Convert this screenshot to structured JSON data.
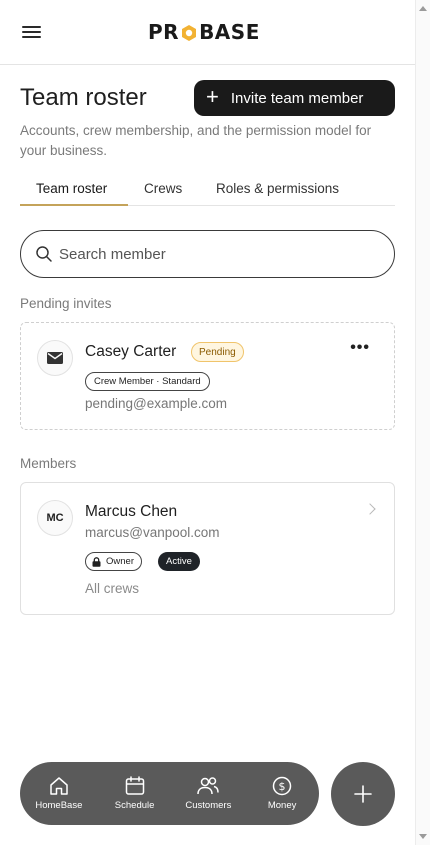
{
  "header": {
    "logo_text_left": "PR",
    "logo_text_right": "BASE",
    "brand_accent": "#F2B233"
  },
  "page": {
    "title": "Team roster",
    "invite_button_label": "Invite team member",
    "subtitle": "Accounts, crew membership, and the permission model for your business."
  },
  "tabs": [
    {
      "label": "Team roster",
      "active": true
    },
    {
      "label": "Crews",
      "active": false
    },
    {
      "label": "Roles & permissions",
      "active": false
    }
  ],
  "search": {
    "placeholder": "Search member",
    "value": ""
  },
  "pending_section": {
    "label": "Pending invites",
    "invites": [
      {
        "name": "Casey Carter",
        "status": "Pending",
        "role": "Crew Member · Standard",
        "email": "pending@example.com",
        "icon": "mail-icon"
      }
    ]
  },
  "members_section": {
    "label": "Members",
    "members": [
      {
        "initials": "MC",
        "name": "Marcus Chen",
        "email": "marcus@vanpool.com",
        "role": "Owner",
        "status": "Active",
        "crews": "All crews"
      }
    ]
  },
  "bottom_nav": [
    {
      "label": "HomeBase",
      "icon": "home-icon"
    },
    {
      "label": "Schedule",
      "icon": "calendar-icon"
    },
    {
      "label": "Customers",
      "icon": "customers-icon"
    },
    {
      "label": "Money",
      "icon": "dollar-icon"
    }
  ],
  "fab": {
    "icon": "plus-icon"
  },
  "colors": {
    "dark": "#1A1A1A",
    "nav_bg": "#5A5A5A",
    "tab_underline": "#C4A35A",
    "pending_badge_bg": "#FFF6E0",
    "pending_badge_border": "#F0C46B"
  }
}
